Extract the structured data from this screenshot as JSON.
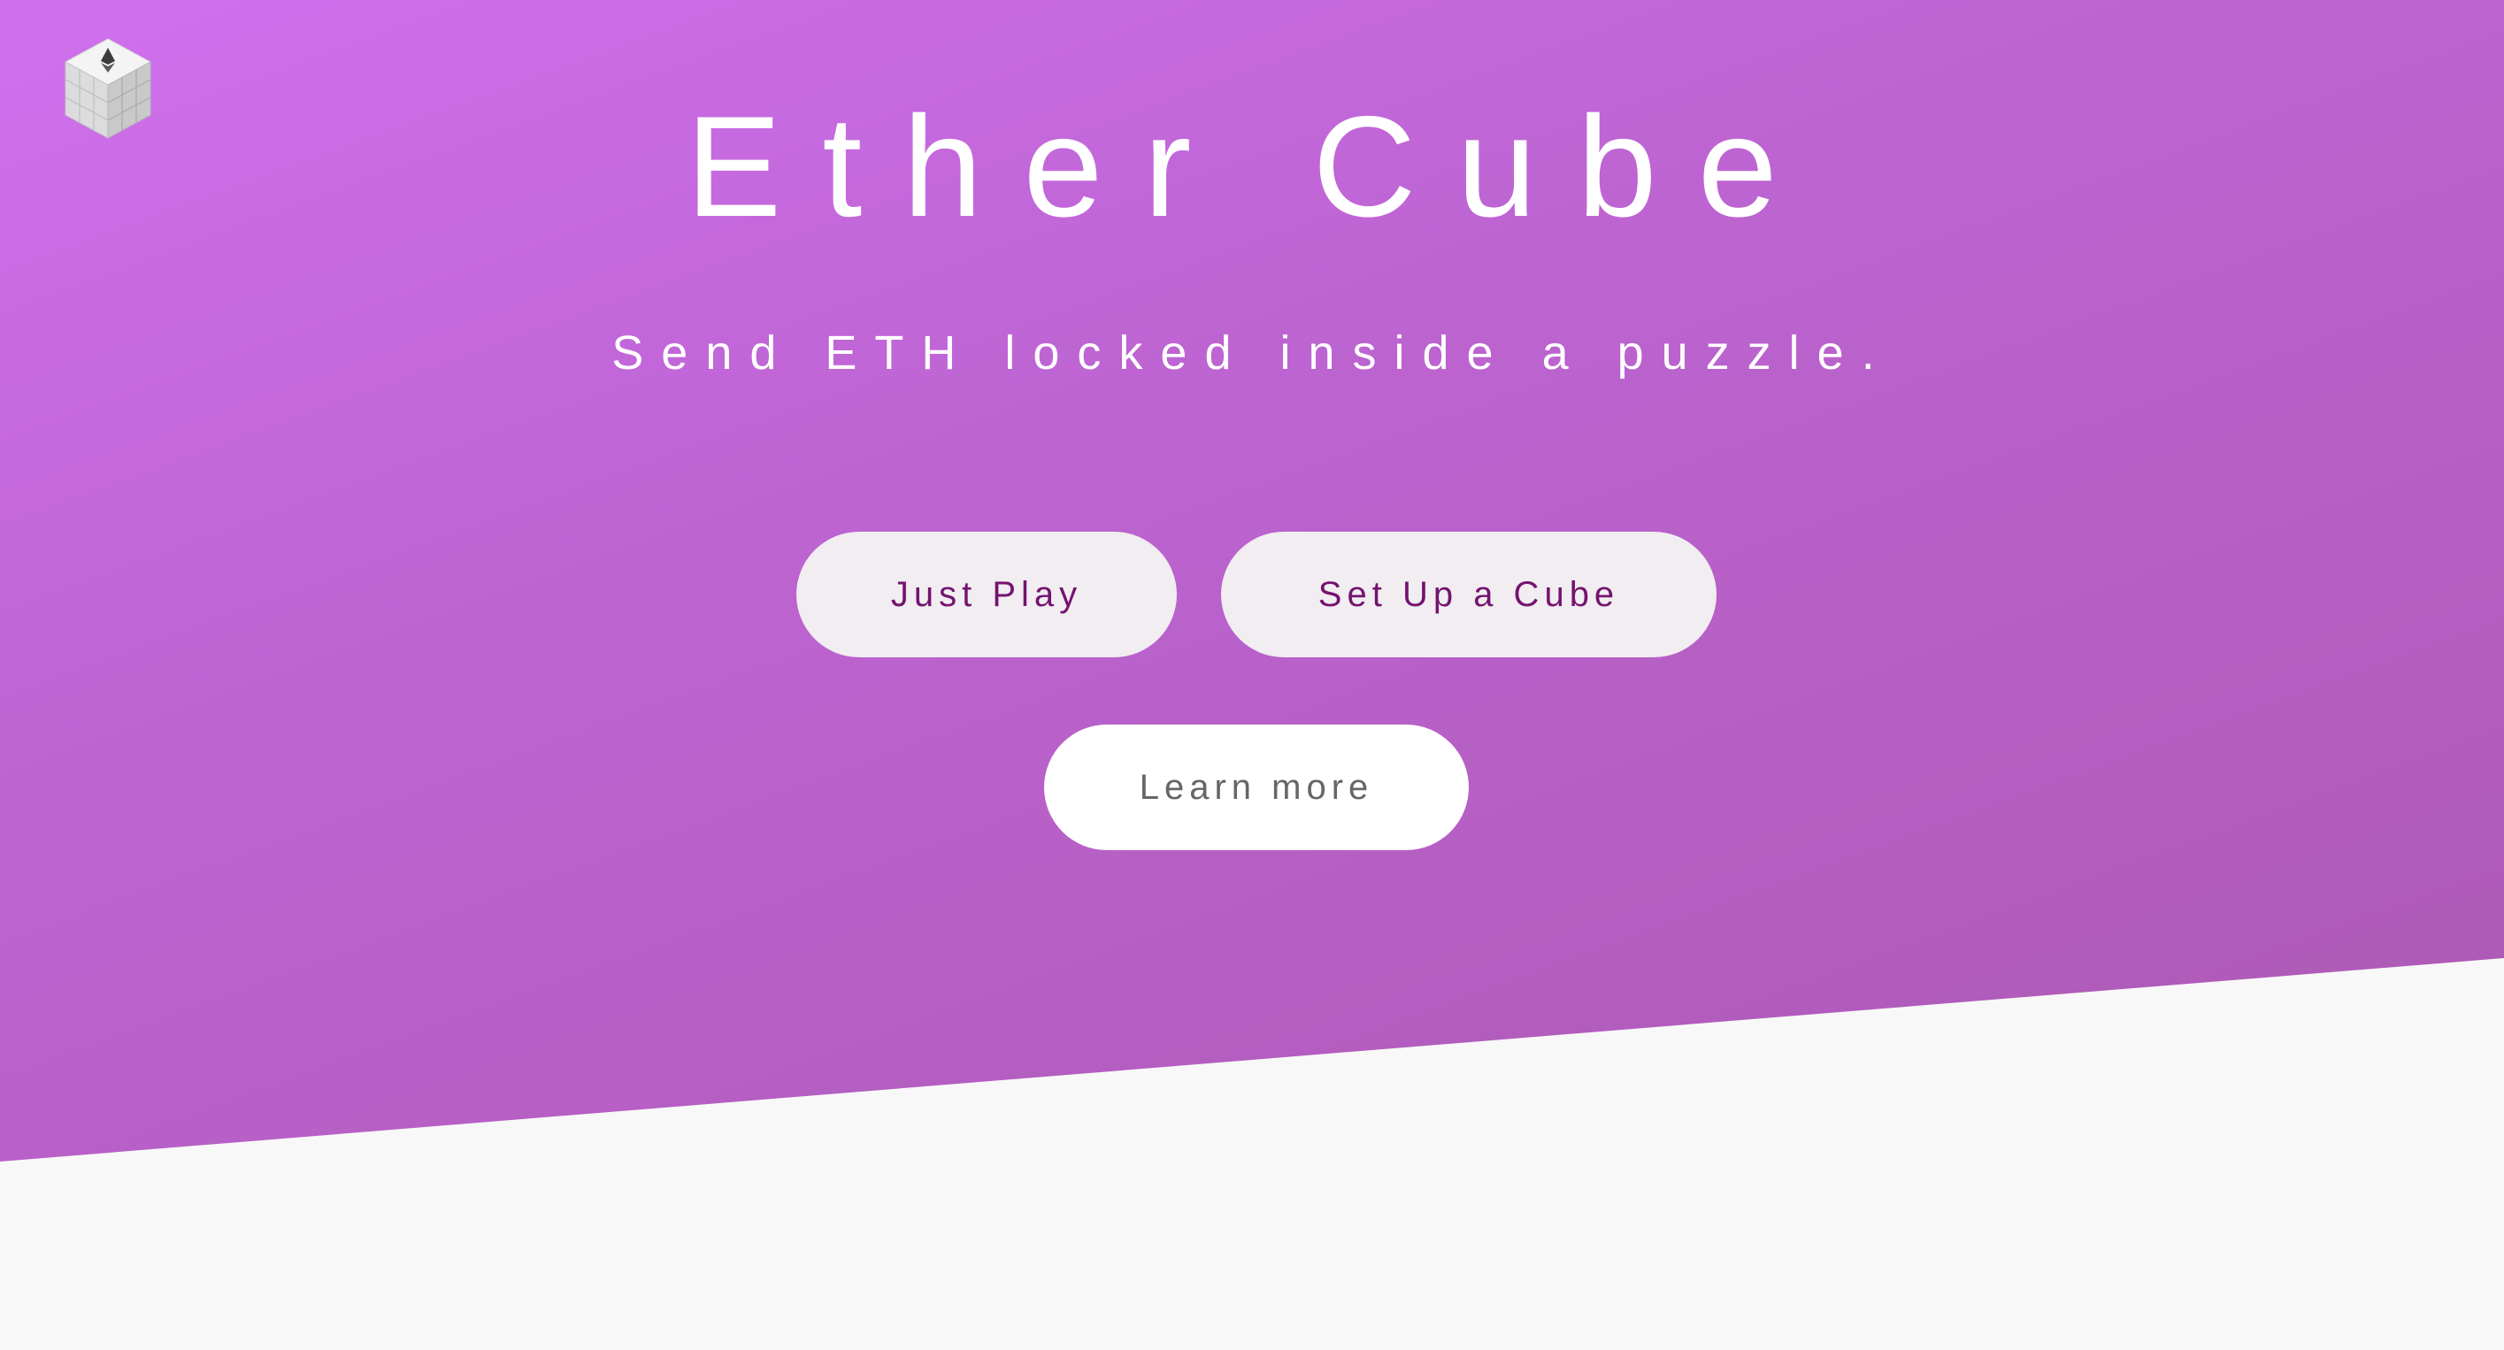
{
  "header": {
    "logo_icon": "ether-cube-logo-icon"
  },
  "hero": {
    "title": "Ether Cube",
    "subtitle": "Send ETH locked inside a puzzle."
  },
  "actions": {
    "just_play_label": "Just Play",
    "set_up_label": "Set Up a Cube",
    "learn_more_label": "Learn more"
  },
  "colors": {
    "gradient_start": "#d070ee",
    "gradient_end": "#a957ad",
    "primary_button_bg": "#f1edf1",
    "primary_button_text": "#74136f",
    "secondary_button_bg": "#ffffff",
    "secondary_button_text": "#666666",
    "page_background": "#f8f8f8"
  }
}
